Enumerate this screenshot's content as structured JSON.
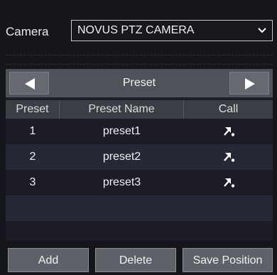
{
  "camera": {
    "label": "Camera",
    "selected": "NOVUS PTZ CAMERA"
  },
  "preset_panel": {
    "title": "Preset",
    "columns": [
      "Preset",
      "Preset Name",
      "Call"
    ],
    "rows": [
      {
        "number": "1",
        "name": "preset1"
      },
      {
        "number": "2",
        "name": "preset2"
      },
      {
        "number": "3",
        "name": "preset3"
      }
    ]
  },
  "buttons": {
    "add": "Add",
    "delete": "Delete",
    "save_position": "Save Position"
  },
  "icons": {
    "prev": "triangle-left-icon",
    "next": "triangle-right-icon",
    "call": "call-preset-arrow-icon",
    "dropdown": "chevron-down-icon"
  }
}
